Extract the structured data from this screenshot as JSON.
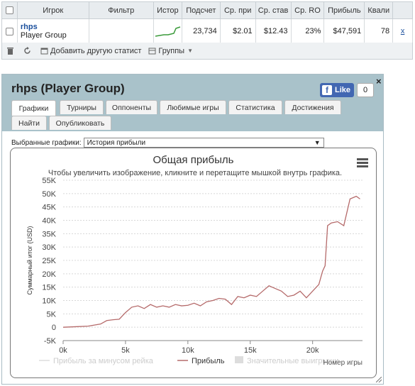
{
  "table": {
    "headers": [
      "Игрок",
      "Фильтр",
      "Истор",
      "Подсчет",
      "Ср. при",
      "Ср. став",
      "Ср. RO",
      "Прибыль",
      "Квали"
    ],
    "row": {
      "player_name": "rhps",
      "player_group": "Player Group",
      "count": "23,734",
      "avg_profit": "$2.01",
      "avg_stake": "$12.43",
      "avg_roi": "23%",
      "profit": "$47,591",
      "quali": "78",
      "remove": "x"
    }
  },
  "toolbar": {
    "add_stat": "Добавить другую статист",
    "groups": "Группы"
  },
  "panel": {
    "title": "rhps (Player Group)",
    "like_label": "Like",
    "like_count": "0",
    "close": "×",
    "tabs": [
      "Графики",
      "Турниры",
      "Оппоненты",
      "Любимые игры",
      "Статистика",
      "Достижения",
      "Найти",
      "Опубликовать"
    ],
    "chart_select_label": "Выбранные графики:",
    "chart_select_value": "История прибыли"
  },
  "chart_data": {
    "type": "line",
    "title": "Общая прибыль",
    "subtitle": "Чтобы увеличить изображение, кликните и перетащите мышкой внутрь графика.",
    "xlabel": "Номер игры",
    "ylabel": "Суммарный итог (USD)",
    "xlim": [
      0,
      24000
    ],
    "ylim": [
      -5000,
      55000
    ],
    "xticks": [
      "0k",
      "5k",
      "10k",
      "15k",
      "20k"
    ],
    "yticks": [
      "-5K",
      "0",
      "5K",
      "10K",
      "15K",
      "20K",
      "25K",
      "30K",
      "35K",
      "40K",
      "45K",
      "50K",
      "55K"
    ],
    "legend": [
      "Прибыль за минусом рейка",
      "Прибыль",
      "Значительные выигрыши"
    ],
    "series": [
      {
        "name": "Прибыль",
        "color": "#b56a6a",
        "x": [
          0,
          1000,
          2000,
          2500,
          3000,
          3500,
          4000,
          4500,
          5000,
          5500,
          6000,
          6500,
          7000,
          7500,
          8000,
          8500,
          9000,
          9500,
          10000,
          10500,
          11000,
          11500,
          12000,
          12500,
          13000,
          13500,
          14000,
          14500,
          15000,
          15500,
          16000,
          16500,
          17000,
          17500,
          18000,
          18500,
          19000,
          19500,
          20000,
          20500,
          20800,
          21000,
          21200,
          21500,
          22000,
          22500,
          23000,
          23500,
          23800
        ],
        "values": [
          0,
          200,
          400,
          800,
          1200,
          2500,
          2800,
          3000,
          5500,
          7500,
          8000,
          7000,
          8500,
          7500,
          8000,
          7500,
          8500,
          8000,
          8200,
          9000,
          8000,
          9500,
          10000,
          10800,
          10500,
          8500,
          11500,
          11000,
          12000,
          11500,
          13500,
          15500,
          14500,
          13500,
          11500,
          12000,
          13500,
          11000,
          13500,
          16000,
          21000,
          23000,
          38000,
          39000,
          39500,
          38000,
          48000,
          49000,
          48000
        ]
      }
    ]
  }
}
